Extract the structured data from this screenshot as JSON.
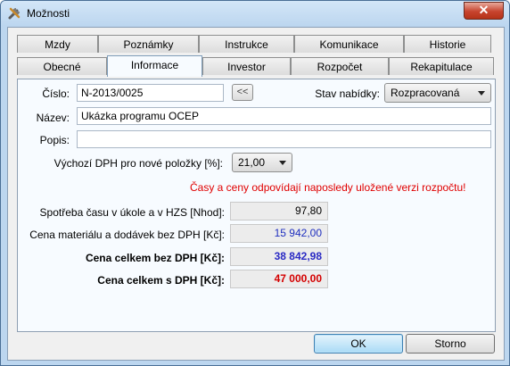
{
  "window": {
    "title": "Možnosti",
    "close_label": "✕"
  },
  "tabs_row1": [
    {
      "label": "Mzdy"
    },
    {
      "label": "Poznámky"
    },
    {
      "label": "Instrukce"
    },
    {
      "label": "Komunikace"
    },
    {
      "label": "Historie"
    }
  ],
  "tabs_row2": [
    {
      "label": "Obecné"
    },
    {
      "label": "Informace",
      "active": true
    },
    {
      "label": "Investor"
    },
    {
      "label": "Rozpočet"
    },
    {
      "label": "Rekapitulace"
    }
  ],
  "form": {
    "cislo_label": "Číslo:",
    "cislo_value": "N-2013/0025",
    "back_button": "<<",
    "stav_label": "Stav nabídky:",
    "stav_value": "Rozpracovaná",
    "nazev_label": "Název:",
    "nazev_value": "Ukázka programu OCEP",
    "popis_label": "Popis:",
    "popis_value": "",
    "dph_label": "Výchozí DPH pro nové položky [%]:",
    "dph_value": "21,00",
    "notice": "Časy a ceny odpovídají naposledy uložené verzi rozpočtu!",
    "rows": [
      {
        "label": "Spotřeba času v úkole a v HZS [Nhod]:",
        "value": "97,80",
        "bold": false,
        "color": "#000000"
      },
      {
        "label": "Cena materiálu a dodávek bez DPH [Kč]:",
        "value": "15 942,00",
        "bold": false,
        "color": "#1f2fbf"
      },
      {
        "label": "Cena celkem bez DPH [Kč]:",
        "value": "38 842,98",
        "bold": true,
        "color": "#2a2ac4"
      },
      {
        "label": "Cena celkem s DPH [Kč]:",
        "value": "47 000,00",
        "bold": true,
        "color": "#d40000"
      }
    ]
  },
  "buttons": {
    "ok": "OK",
    "cancel": "Storno"
  }
}
